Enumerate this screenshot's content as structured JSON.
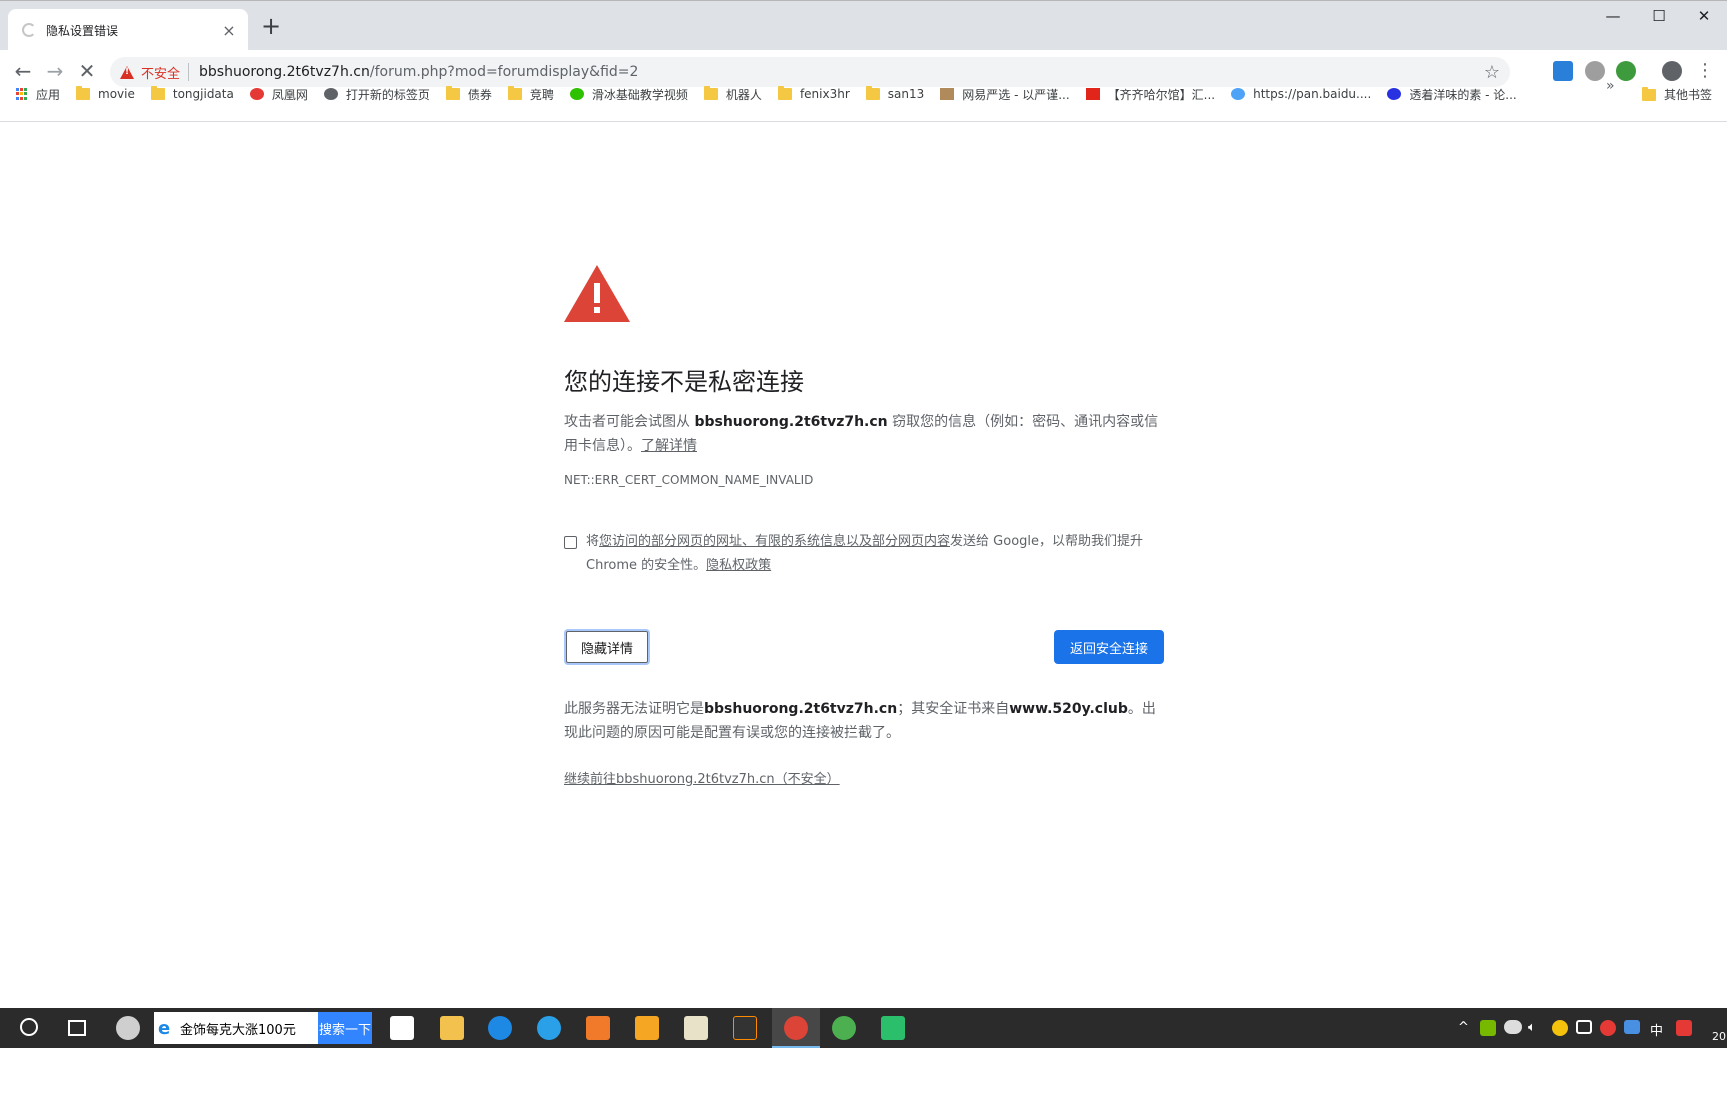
{
  "browser": {
    "tab_title": "隐私设置错误",
    "new_tab": "+",
    "win_minimize": "—",
    "win_maximize": "☐",
    "win_close": "✕",
    "insecure_label": "不安全",
    "url_host": "bbshuorong.2t6tvz7h.cn",
    "url_path": "/forum.php?mod=forumdisplay&fid=2"
  },
  "bookmarks": {
    "items": [
      "应用",
      "movie",
      "tongjidata",
      "凤凰网",
      "打开新的标签页",
      "债券",
      "竞聘",
      "滑冰基础教学视频",
      "机器人",
      "fenix3hr",
      "san13",
      "网易严选 - 以严谨...",
      "【齐齐哈尔馆】汇...",
      "https://pan.baidu....",
      "透着洋味的素 - 论..."
    ],
    "overflow": "»",
    "other": "其他书签"
  },
  "page": {
    "heading": "您的连接不是私密连接",
    "para_prefix": "攻击者可能会试图从 ",
    "para_host": "bbshuorong.2t6tvz7h.cn",
    "para_suffix": " 窃取您的信息（例如：密码、通讯内容或信用卡信息）。",
    "learn_more": "了解详情",
    "error_code": "NET::ERR_CERT_COMMON_NAME_INVALID",
    "check_prefix": "将",
    "check_link": "您访问的部分网页的网址、有限的系统信息以及部分网页内容",
    "check_mid": "发送给 Google，以帮助我们提升 Chrome 的安全性。",
    "privacy_policy": "隐私权政策",
    "hide_details": "隐藏详情",
    "back_to_safety": "返回安全连接",
    "details_prefix": "此服务器无法证明它是",
    "details_host": "bbshuorong.2t6tvz7h.cn",
    "details_mid": "；其安全证书来自",
    "details_issuer": "www.520y.club",
    "details_suffix": "。出现此问题的原因可能是配置有误或您的连接被拦截了。",
    "proceed_link": "继续前往bbshuorong.2t6tvz7h.cn（不安全）"
  },
  "taskbar": {
    "search_value": "金饰每克大涨100元",
    "search_button": "搜索一下",
    "tray_lang": "中",
    "tray_time_partial": "20"
  }
}
